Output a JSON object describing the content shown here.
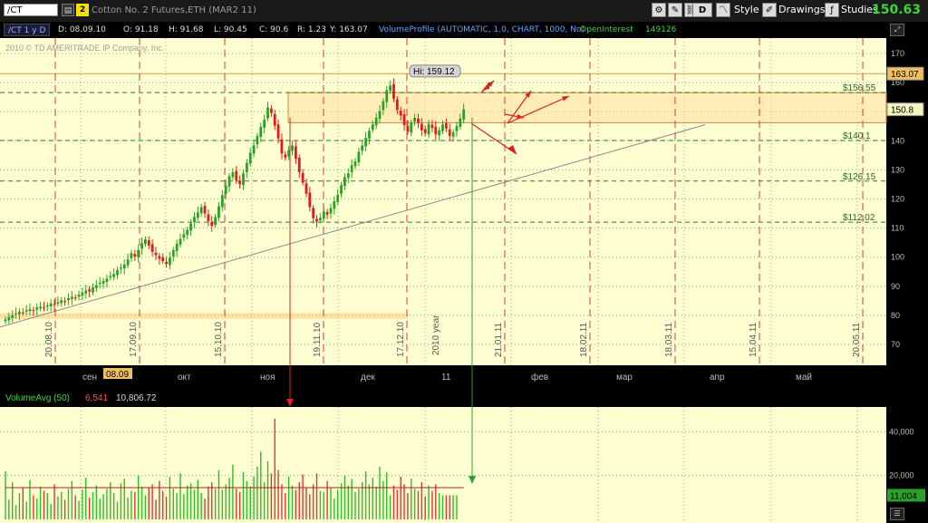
{
  "toolbar": {
    "symbol_input": "/CT",
    "link_badge": "2",
    "symbol_description": "Cotton No. 2 Futures,ETH (MAR2 11)",
    "aggregation_button": "D",
    "style_label": "Style",
    "drawings_label": "Drawings",
    "studies_label": "Studies",
    "last_price": "150.63"
  },
  "info_bar": {
    "period": "/CT 1 y D",
    "date": "D: 08.09.10",
    "open": "O: 91.18",
    "high": "H: 91.68",
    "low": "L: 90.45",
    "close": "C: 90.6",
    "range": "R: 1.23",
    "y": "Y: 163.07",
    "volume_profile": "VolumeProfile (AUTOMATIC, 1.0, CHART, 1000, No)",
    "oi_label": "OpenInterest",
    "oi_value": "149126"
  },
  "watermark": "2010 © TD AMERITRADE IP Company, Inc.",
  "colors": {
    "chart_bg": "#ffffd2",
    "up_candle": "#26a326",
    "down_candle": "#e81818",
    "gridline": "#7fb07f",
    "date_line": "#e53535",
    "volume_bar_up": "#2bbd2b",
    "volume_bar_down": "#e63434",
    "volume_avg_line": "#b32222",
    "price_label_bg": "#f0c060",
    "value_area": "#ffdca0"
  },
  "chart_data": [
    {
      "type": "candlestick",
      "y_axis_ticks": [
        170,
        160,
        150,
        140,
        130,
        120,
        110,
        100,
        90,
        80,
        70
      ],
      "ylim": [
        62,
        175
      ],
      "price_labels": [
        {
          "value": 163.07,
          "text": "163.07"
        },
        {
          "value": 150.8,
          "text": "150.8"
        }
      ],
      "level_lines": [
        {
          "value": 156.55,
          "text": "$156.55"
        },
        {
          "value": 140.1,
          "text": "$140.1"
        },
        {
          "value": 126.15,
          "text": "$126.15"
        },
        {
          "value": 112.02,
          "text": "$112.02"
        }
      ],
      "high_annotation": {
        "text": "Hi: 159.12",
        "value": 159.12
      },
      "month_labels": [
        "сен",
        "окт",
        "ноя",
        "дек",
        "11",
        "фев",
        "мар",
        "апр",
        "май"
      ],
      "cursor_date_label": "08.09",
      "date_lines": [
        {
          "text": "20.08.10"
        },
        {
          "text": "17.09.10"
        },
        {
          "text": "15.10.10"
        },
        {
          "text": "19.11.10"
        },
        {
          "text": "17.12.10"
        },
        {
          "text": "21.01.11"
        },
        {
          "text": "18.02.11"
        },
        {
          "text": "18.03.11"
        },
        {
          "text": "15.04.11"
        },
        {
          "text": "20.05.11"
        }
      ],
      "year_label": "2010 year",
      "closes": [
        78.6,
        79.4,
        80.0,
        80.7,
        81.3,
        80.9,
        81.8,
        82.1,
        81.5,
        82.7,
        83.0,
        82.6,
        83.4,
        84.1,
        83.6,
        84.5,
        85.2,
        84.8,
        85.9,
        86.4,
        86.0,
        87.1,
        87.8,
        88.5,
        88.2,
        89.6,
        90.4,
        91.2,
        91.8,
        92.6,
        93.5,
        94.2,
        95.6,
        96.4,
        97.5,
        99.2,
        101.4,
        100.2,
        102.5,
        104.8,
        106.1,
        104.0,
        101.8,
        100.7,
        99.5,
        98.7,
        97.6,
        99.8,
        102.4,
        104.6,
        106.3,
        107.9,
        109.4,
        111.6,
        113.8,
        115.4,
        117.2,
        115.0,
        112.4,
        110.7,
        113.8,
        117.5,
        121.3,
        124.6,
        127.8,
        129.2,
        126.4,
        125.1,
        128.8,
        132.4,
        135.9,
        138.4,
        141.6,
        144.8,
        147.3,
        151.4,
        149.5,
        145.2,
        140.8,
        135.6,
        134.2,
        136.8,
        138.4,
        133.8,
        129.2,
        125.6,
        121.8,
        117.2,
        113.4,
        112.2,
        113.5,
        115.8,
        114.6,
        116.9,
        119.2,
        121.4,
        124.8,
        127.5,
        128.8,
        131.6,
        132.9,
        136.2,
        138.4,
        141.0,
        143.4,
        145.6,
        147.9,
        150.2,
        153.6,
        157.4,
        159.0,
        154.5,
        150.6,
        148.7,
        145.4,
        143.1,
        146.2,
        147.9,
        146.1,
        143.6,
        142.5,
        145.8,
        144.4,
        142.2,
        143.6,
        145.6,
        144.2,
        141.7,
        142.9,
        145.1,
        147.6,
        150.8
      ],
      "volume_pane": {
        "study_label": "VolumeAvg (50)",
        "study_value_1": "6,541",
        "study_value_2": "10,806.72",
        "y_axis_ticks": [
          "40,000",
          "20,000"
        ],
        "ylim": [
          0,
          48000
        ],
        "current_volume_label": "11,004",
        "current_volume": 11004,
        "average": 14500,
        "volumes": [
          22000,
          9000,
          17000,
          6500,
          12000,
          14500,
          8000,
          18000,
          11000,
          9500,
          15000,
          13000,
          12000,
          7000,
          16000,
          10500,
          12500,
          9000,
          14000,
          17500,
          11000,
          8500,
          13500,
          19000,
          10000,
          12500,
          15500,
          9500,
          11500,
          14000,
          17000,
          12000,
          8000,
          16500,
          18500,
          10000,
          13000,
          12500,
          20000,
          15000,
          11000,
          14500,
          16000,
          9000,
          17500,
          13000,
          10500,
          19500,
          14000,
          12000,
          21000,
          11500,
          15500,
          16500,
          13500,
          18000,
          12000,
          9500,
          15000,
          17000,
          14000,
          22500,
          13500,
          16000,
          19000,
          25000,
          14000,
          12500,
          21500,
          17500,
          15000,
          19500,
          24000,
          31000,
          17000,
          26500,
          21000,
          46000,
          22500,
          16000,
          12000,
          19500,
          15500,
          13500,
          17000,
          20500,
          14500,
          11500,
          16000,
          21000,
          13000,
          12500,
          17500,
          14500,
          9500,
          13500,
          16500,
          20000,
          15500,
          18500,
          12500,
          14000,
          17000,
          22000,
          16000,
          19000,
          15000,
          24000,
          17500,
          21500,
          11000,
          15500,
          13500,
          19500,
          16000,
          12000,
          18500,
          14000,
          13000,
          17000,
          10500,
          15500,
          13000,
          16000,
          12000,
          11004,
          11004,
          11004,
          11004,
          11004
        ]
      }
    }
  ]
}
